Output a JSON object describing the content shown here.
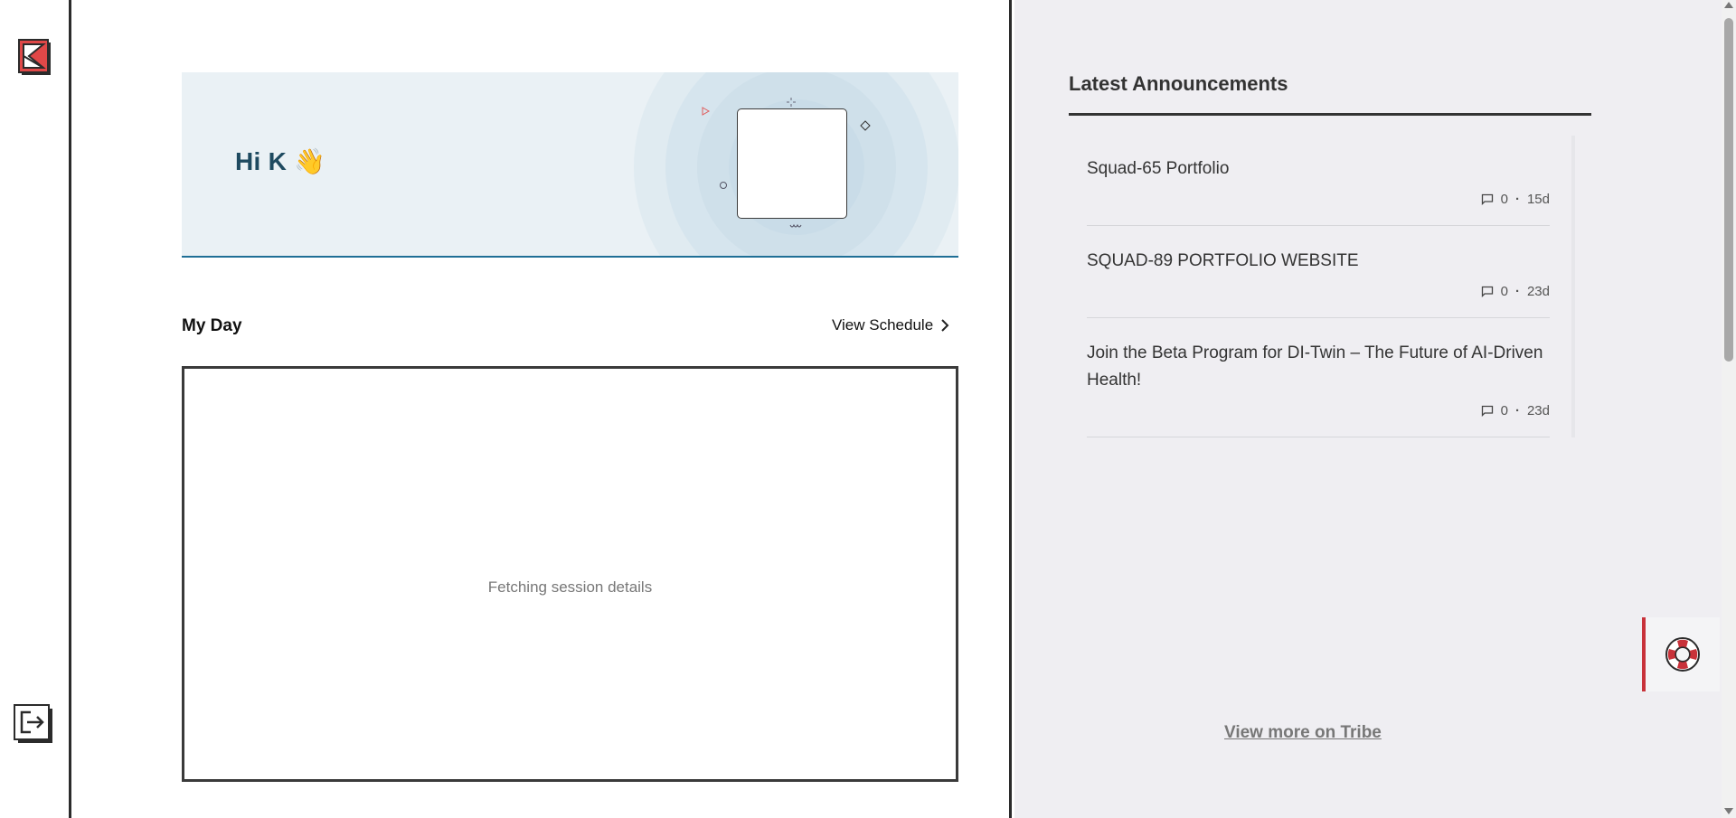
{
  "rail": {
    "logo_icon": "kl-logo-icon",
    "logout_icon": "logout-icon"
  },
  "hero": {
    "greeting": "Hi K",
    "wave": "👋"
  },
  "my_day": {
    "title": "My Day",
    "view_schedule_label": "View Schedule",
    "session_status": "Fetching session details"
  },
  "announcements": {
    "title": "Latest Announcements",
    "items": [
      {
        "title": "Squad-65 Portfolio",
        "comments": "0",
        "separator": "·",
        "age": "15d"
      },
      {
        "title": "SQUAD-89 PORTFOLIO WEBSITE",
        "comments": "0",
        "separator": "·",
        "age": "23d"
      },
      {
        "title": "Join the Beta Program for DI-Twin – The Future of AI-Driven Health!",
        "comments": "0",
        "separator": "·",
        "age": "23d"
      }
    ],
    "view_more_label": "View more on Tribe"
  },
  "help": {
    "icon": "lifebuoy-icon"
  },
  "colors": {
    "accent_red": "#c8323a",
    "hero_bg": "#eaf1f5",
    "hero_text": "#1e4a60",
    "panel_bg": "#efeef2"
  }
}
